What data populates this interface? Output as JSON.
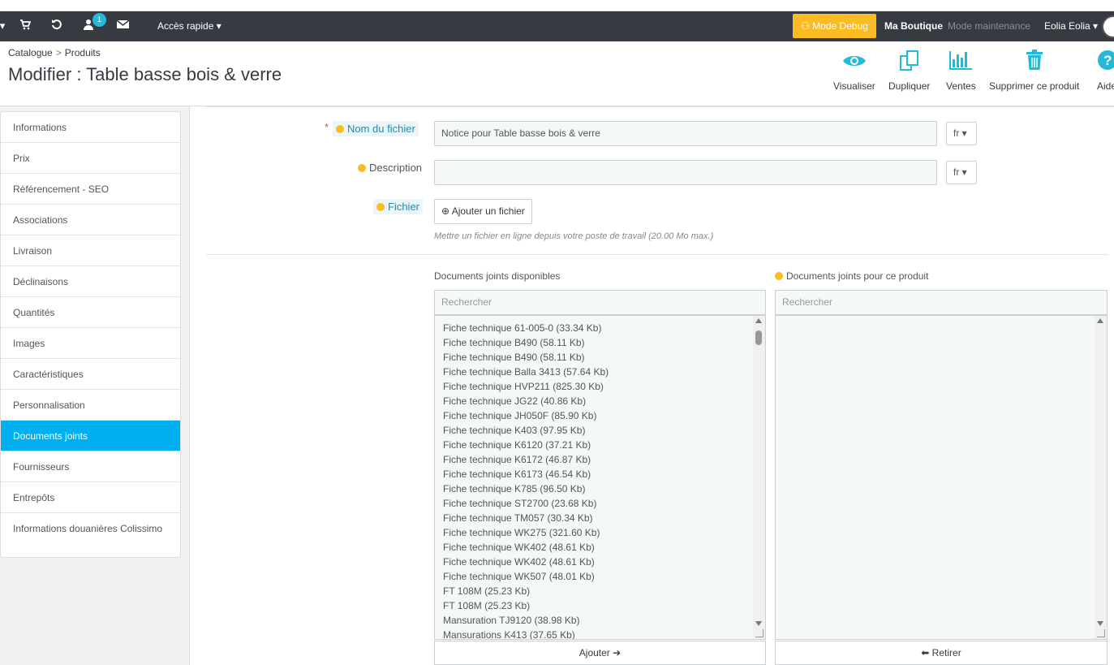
{
  "header": {
    "notif_count": "1",
    "quick_access": "Accès rapide ▾",
    "debug_label": "Mode Debug",
    "shop_name": "Ma Boutique",
    "maintenance": "Mode maintenance",
    "user": "Eolia Eolia ▾"
  },
  "breadcrumb": {
    "level1": "Catalogue",
    "sep": ">",
    "level2": "Produits"
  },
  "page_title": "Modifier : Table basse bois & verre",
  "toolbar": {
    "view": "Visualiser",
    "duplicate": "Dupliquer",
    "sales": "Ventes",
    "delete": "Supprimer ce produit",
    "help": "Aide"
  },
  "menu": [
    "Informations",
    "Prix",
    "Référencement - SEO",
    "Associations",
    "Livraison",
    "Déclinaisons",
    "Quantités",
    "Images",
    "Caractéristiques",
    "Personnalisation",
    "Documents joints",
    "Fournisseurs",
    "Entrepôts",
    "Informations douanières Colissimo"
  ],
  "form": {
    "required_mark": "*",
    "filename_label": "Nom du fichier",
    "filename_value": "Notice pour Table basse bois & verre",
    "lang": "fr ▾",
    "description_label": "Description",
    "description_value": "",
    "file_label": "Fichier",
    "add_file_button": "Ajouter un fichier",
    "help_text": "Mettre un fichier en ligne depuis votre poste de travail (20.00 Mo max.)"
  },
  "attachments": {
    "available_label": "Documents joints disponibles",
    "product_label": "Documents joints pour ce produit",
    "search_placeholder": "Rechercher",
    "available_items": [
      "Fiche technique 61-005-0 (33.34 Kb)",
      "Fiche technique B490 (58.11 Kb)",
      "Fiche technique B490 (58.11 Kb)",
      "Fiche technique Balla 3413 (57.64 Kb)",
      "Fiche technique HVP211 (825.30 Kb)",
      "Fiche technique JG22 (40.86 Kb)",
      "Fiche technique JH050F (85.90 Kb)",
      "Fiche technique K403 (97.95 Kb)",
      "Fiche technique K6120 (37.21 Kb)",
      "Fiche technique K6172 (46.87 Kb)",
      "Fiche technique K6173 (46.54 Kb)",
      "Fiche technique K785 (96.50 Kb)",
      "Fiche technique ST2700 (23.68 Kb)",
      "Fiche technique TM057 (30.34 Kb)",
      "Fiche technique WK275 (321.60 Kb)",
      "Fiche technique WK402 (48.61 Kb)",
      "Fiche technique WK402 (48.61 Kb)",
      "Fiche technique WK507 (48.01 Kb)",
      "FT 108M (25.23 Kb)",
      "FT 108M (25.23 Kb)",
      "Mansuration TJ9120 (38.98 Kb)",
      "Mansurations K413 (37.65 Kb)"
    ],
    "add_button": "Ajouter ➔",
    "remove_button": "⬅ Retirer"
  }
}
